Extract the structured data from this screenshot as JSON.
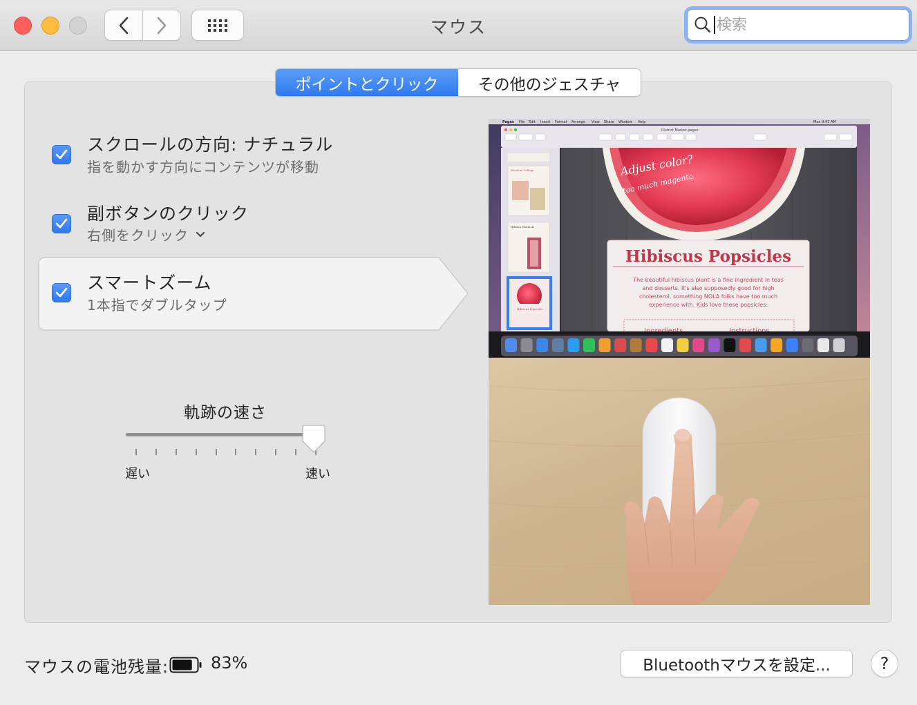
{
  "window": {
    "title": "マウス"
  },
  "search": {
    "placeholder": "検索",
    "value": ""
  },
  "tabs": [
    {
      "label": "ポイントとクリック",
      "selected": true
    },
    {
      "label": "その他のジェスチャ",
      "selected": false
    }
  ],
  "options": [
    {
      "title": "スクロールの方向: ナチュラル",
      "subtitle": "指を動かす方向にコンテンツが移動",
      "checked": true
    },
    {
      "title": "副ボタンのクリック",
      "subtitle": "右側をクリック",
      "checked": true,
      "has_dropdown": true
    },
    {
      "title": "スマートズーム",
      "subtitle": "1本指でダブルタップ",
      "checked": true,
      "selected": true
    }
  ],
  "tracking_speed": {
    "label": "軌跡の速さ",
    "min_label": "遅い",
    "max_label": "速い",
    "value_fraction": 0.95,
    "tick_count": 10
  },
  "preview": {
    "menubar": [
      "Pages",
      "File",
      "Edit",
      "Insert",
      "Format",
      "Arrange",
      "View",
      "Share",
      "Window",
      "Help"
    ],
    "clock": "Mon 9:41 AM",
    "document_title": "District Market.pages",
    "handwriting_1": "Adjust color?",
    "handwriting_2": "too much magenta",
    "card_title": "Hibiscus Popsicles",
    "card_body_1": "The beautiful hibiscus plant is a fine ingredient in teas",
    "card_body_2": "and desserts. It's also supposedly good for high",
    "card_body_3": "cholesterol, something NOLA folks have too much",
    "card_body_4": "experience with. Kids love these popsicles:",
    "ingredients": "Ingredients",
    "instructions": "Instructions",
    "thumb_1": "Winslow College",
    "thumb_2": "Hibisco Warm Ai",
    "thumb_3": "Hibiscus Popsicles"
  },
  "footer": {
    "battery_label": "マウスの電池残量:",
    "battery_percent": "83%",
    "battery_level": 0.83,
    "bluetooth_button": "Bluetoothマウスを設定...",
    "help_button": "?"
  },
  "colors": {
    "accent": "#3a84f3",
    "close": "#fc605c",
    "minimize": "#fdbc40",
    "zoom_disabled": "#d2d2d2"
  }
}
